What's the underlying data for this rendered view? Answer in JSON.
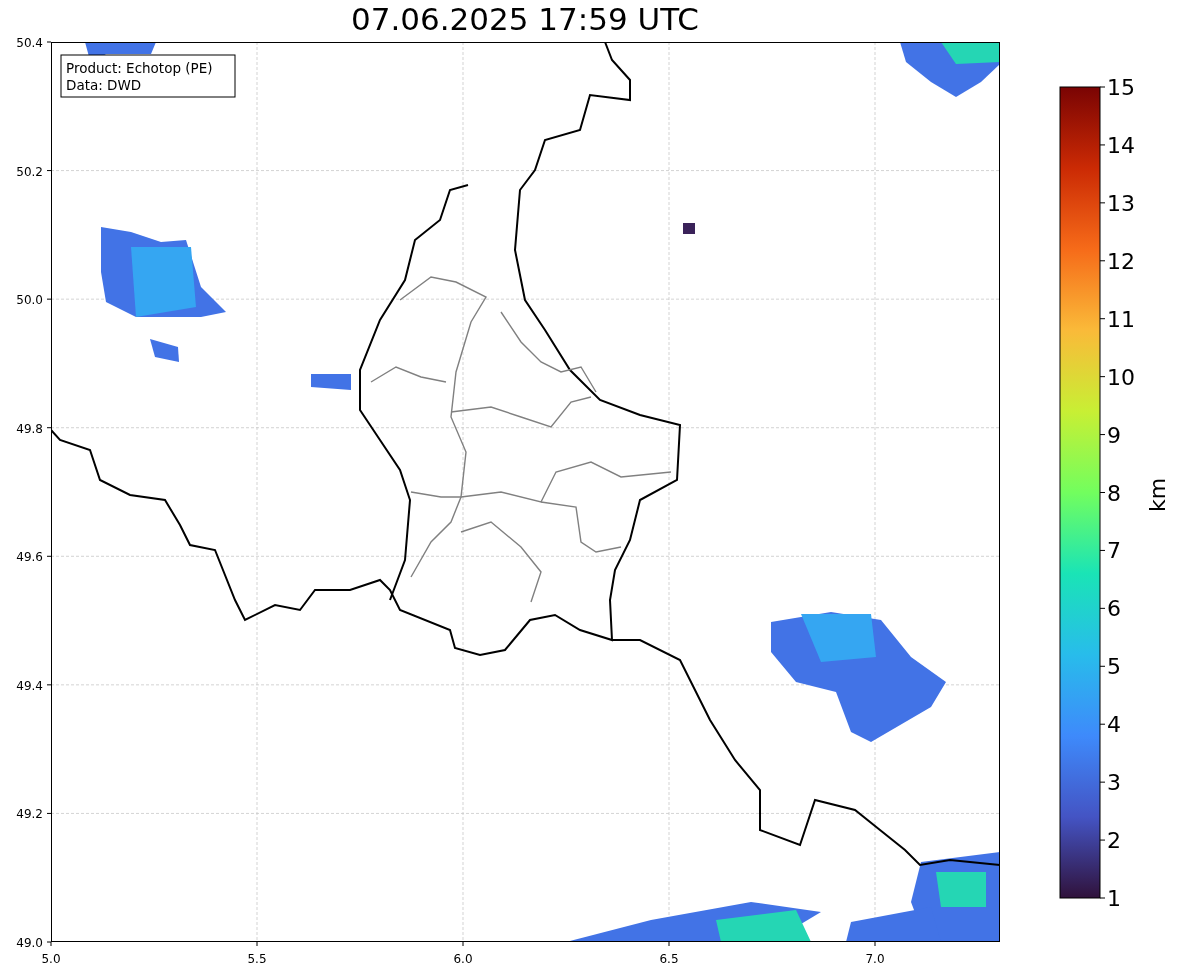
{
  "title": "07.06.2025 17:59 UTC",
  "legend": [
    "Product: Echotop (PE)",
    "Data: DWD"
  ],
  "x_ticks": [
    "5.0",
    "5.5",
    "6.0",
    "6.5",
    "7.0"
  ],
  "y_ticks": [
    "50.4",
    "50.2",
    "50.0",
    "49.8",
    "49.6",
    "49.4",
    "49.2",
    "49.0"
  ],
  "colorbar": {
    "label": "km",
    "ticks": [
      "15",
      "14",
      "13",
      "12",
      "11",
      "10",
      "9",
      "8",
      "7",
      "6",
      "5",
      "4",
      "3",
      "2",
      "1"
    ]
  }
}
